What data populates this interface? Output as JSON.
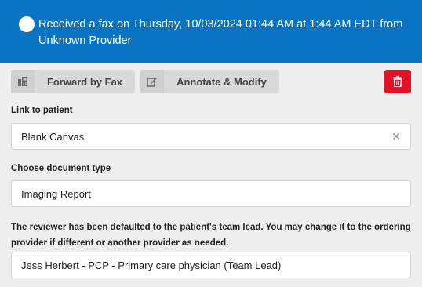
{
  "header": {
    "message": "Received a fax on Thursday, 10/03/2024 01:44 AM at 1:44 AM EDT from Unknown Provider"
  },
  "toolbar": {
    "forward_label": "Forward by Fax",
    "annotate_label": "Annotate & Modify",
    "forward_icon": "fax-icon",
    "annotate_icon": "edit-icon",
    "delete_icon": "trash-icon"
  },
  "patient": {
    "label": "Link to patient",
    "value": "Blank Canvas"
  },
  "doc_type": {
    "label": "Choose document type",
    "value": "Imaging Report"
  },
  "reviewer": {
    "note": "The reviewer has been defaulted to the patient's team lead. You may change it to the ordering provider if different or another provider as needed.",
    "value": "Jess Herbert - PCP - Primary care physician (Team Lead)"
  },
  "colors": {
    "header_bg": "#0a74c4",
    "delete_bg": "#e0122a",
    "page_bg": "#eeeeee"
  }
}
